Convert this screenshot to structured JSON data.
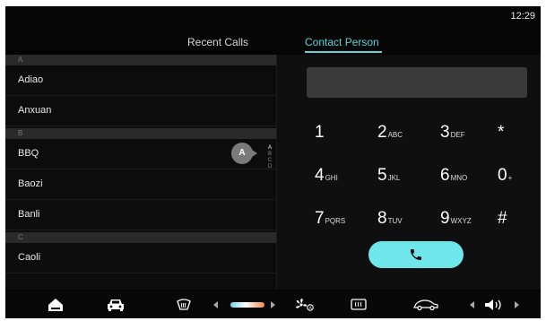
{
  "status": {
    "time": "12:29"
  },
  "tabs": [
    {
      "label": "Recent Calls",
      "active": false
    },
    {
      "label": "Contact Person",
      "active": true
    }
  ],
  "contacts": {
    "sections": [
      {
        "letter": "A",
        "items": [
          "Adiao",
          "Anxuan"
        ]
      },
      {
        "letter": "B",
        "items": [
          "BBQ",
          "Baozi",
          "Banli"
        ]
      },
      {
        "letter": "C",
        "items": [
          "Caoli"
        ]
      }
    ],
    "current_letter": "A",
    "index_letters": [
      "A",
      "B",
      "C",
      "D"
    ]
  },
  "dialpad": {
    "display_value": "",
    "keys": [
      {
        "digit": "1",
        "letters": ""
      },
      {
        "digit": "2",
        "letters": "ABC"
      },
      {
        "digit": "3",
        "letters": "DEF"
      },
      {
        "digit": "*",
        "letters": ""
      },
      {
        "digit": "4",
        "letters": "GHI"
      },
      {
        "digit": "5",
        "letters": "JKL"
      },
      {
        "digit": "6",
        "letters": "MNO"
      },
      {
        "digit": "0",
        "letters": "+"
      },
      {
        "digit": "7",
        "letters": "PQRS"
      },
      {
        "digit": "8",
        "letters": "TUV"
      },
      {
        "digit": "9",
        "letters": "WXYZ"
      },
      {
        "digit": "#",
        "letters": ""
      }
    ],
    "call_icon": "phone-icon"
  },
  "bottom_bar": {
    "icons": [
      "home-icon",
      "car-icon",
      "front-defrost-icon",
      "fan-auto-icon",
      "rear-defrost-icon",
      "car-side-icon",
      "volume-icon"
    ]
  },
  "colors": {
    "accent": "#59d6db",
    "call_button": "#6fe6ea",
    "background": "#050505"
  }
}
